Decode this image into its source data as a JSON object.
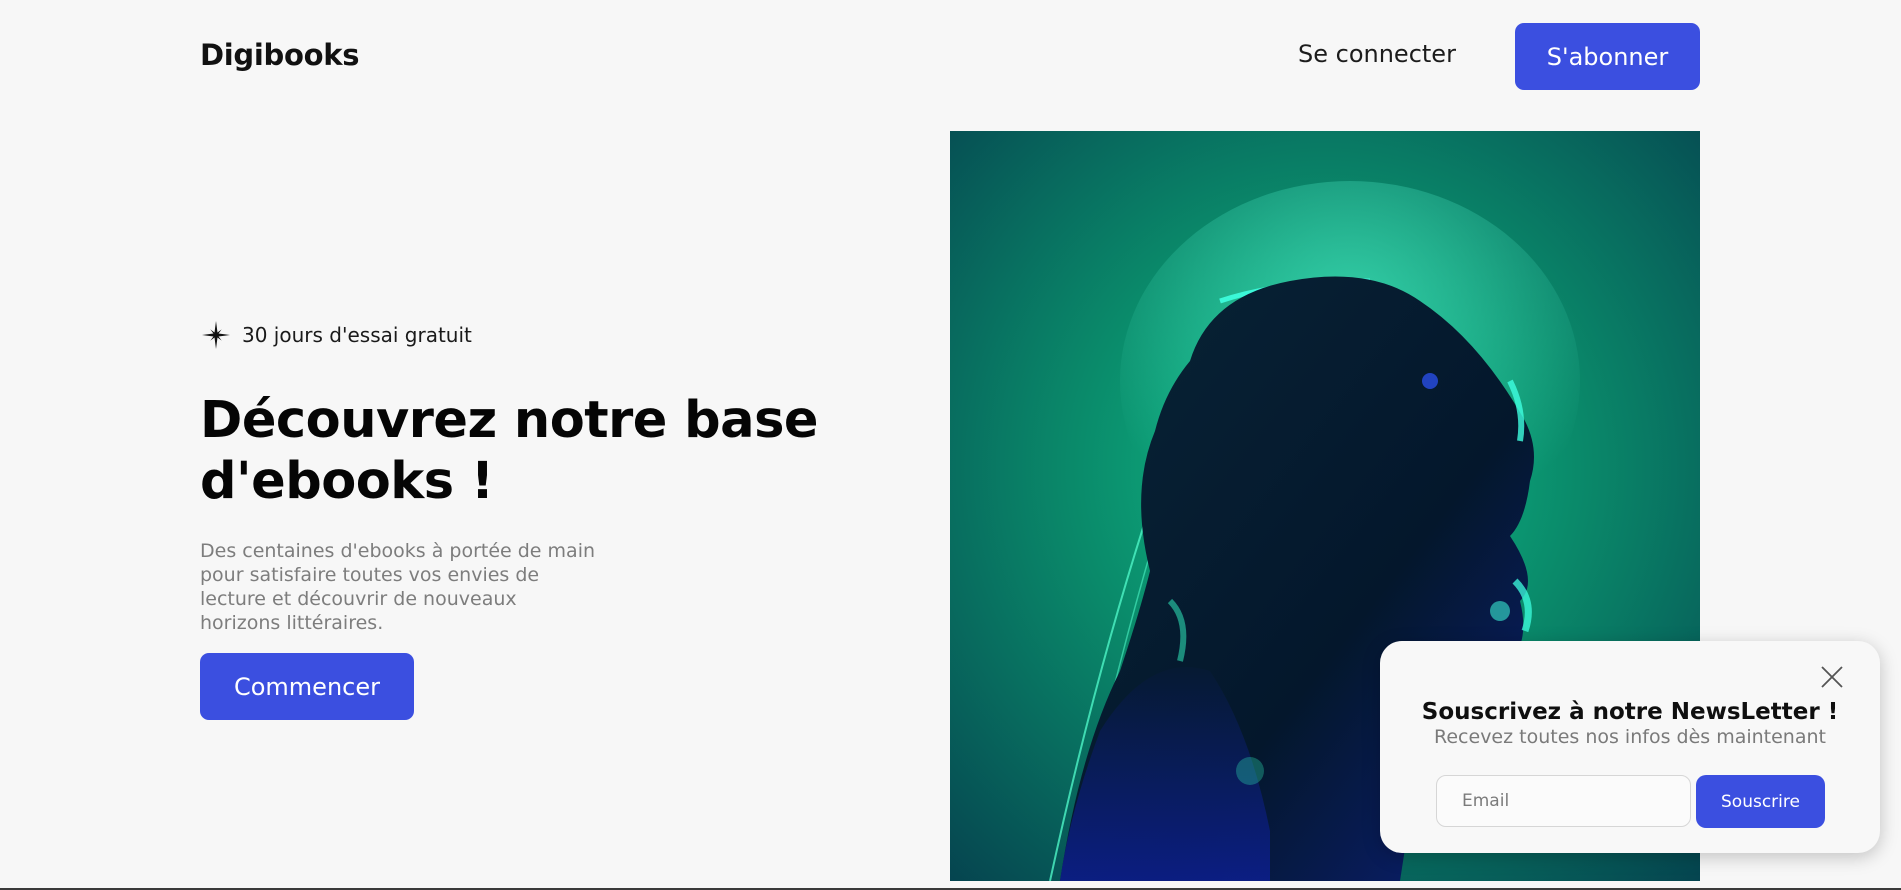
{
  "header": {
    "logo": "Digibooks",
    "login_label": "Se connecter",
    "subscribe_label": "S'abonner"
  },
  "hero": {
    "trial_icon": "sparkle-icon",
    "trial_text": "30 jours d'essai gratuit",
    "title": "Découvrez notre base d'ebooks !",
    "description": "Des centaines d'ebooks à portée de main pour satisfaire toutes vos envies de lecture et découvrir de nouveaux horizons littéraires.",
    "cta_label": "Commencer",
    "image": "illustration of a glossy translucent head in profile glowing against a teal background"
  },
  "newsletter": {
    "close_icon": "close-icon",
    "title": "Souscrivez à notre NewsLetter !",
    "subtitle": "Recevez toutes nos infos dès maintenant",
    "email_placeholder": "Email",
    "email_value": "",
    "submit_label": "Souscrire"
  },
  "colors": {
    "accent": "#3b4fe0",
    "background": "#f7f7f7",
    "image_bg": "#0b6a5a"
  }
}
